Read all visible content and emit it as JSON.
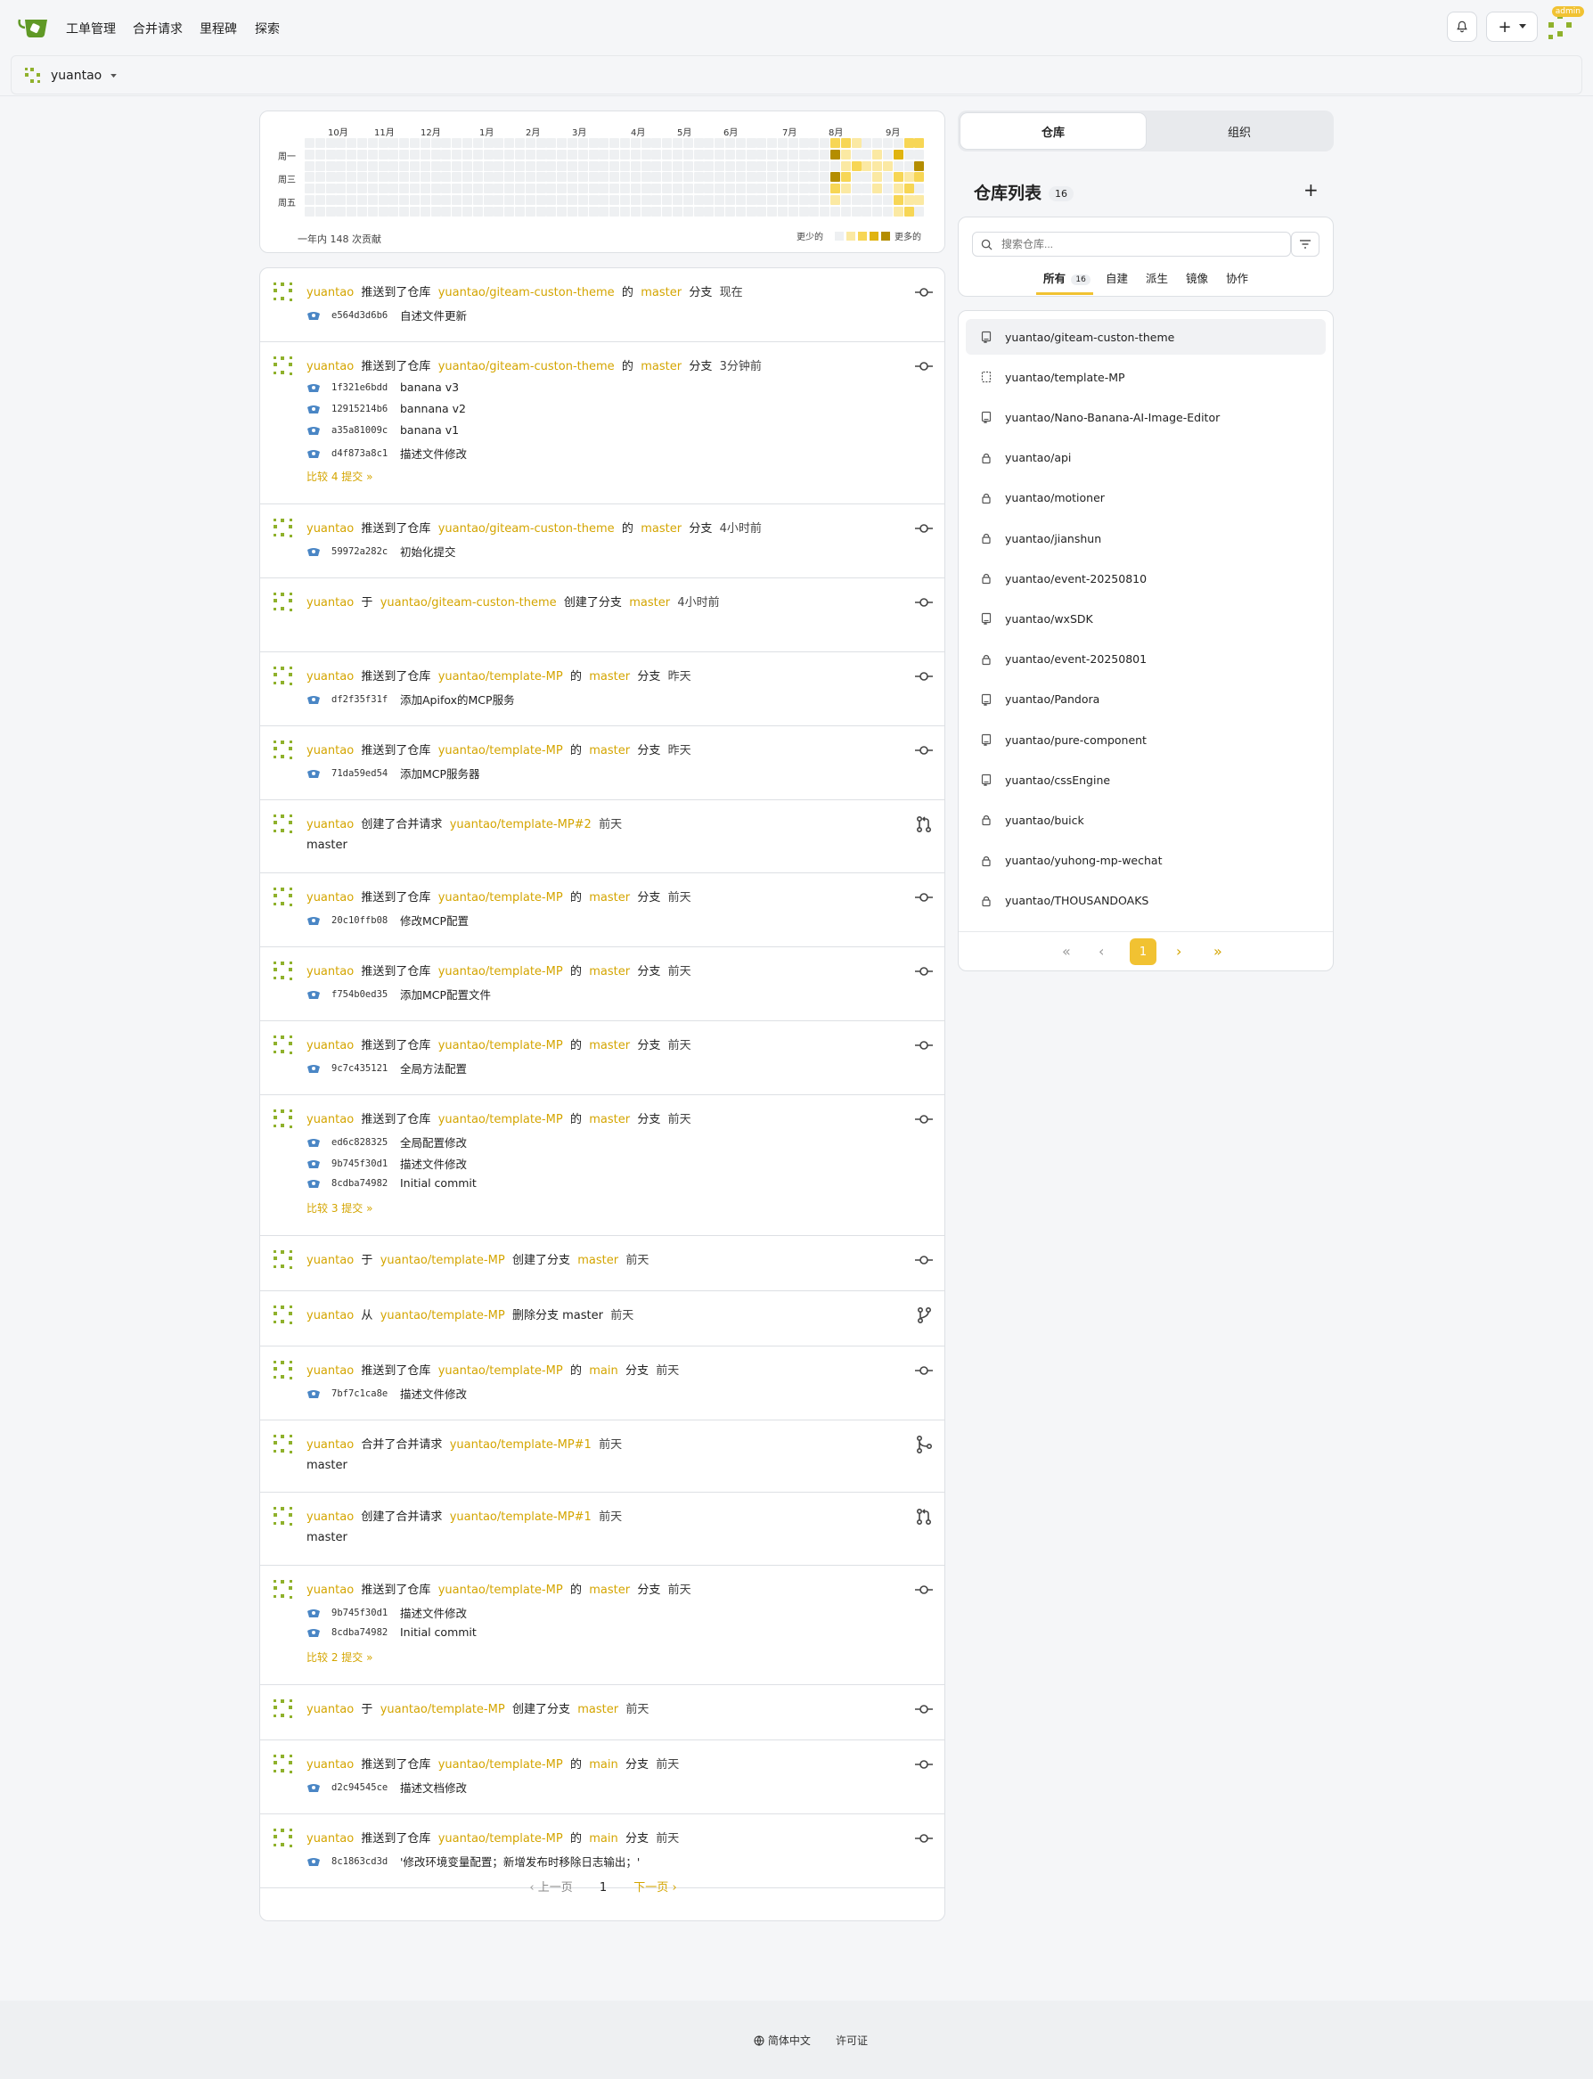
{
  "nav": {
    "items": [
      "工单管理",
      "合并请求",
      "里程碑",
      "探索"
    ],
    "admin_badge": "admin"
  },
  "context": {
    "user": "yuantao"
  },
  "heatmap": {
    "months": [
      "10月",
      "11月",
      "12月",
      "1月",
      "2月",
      "3月",
      "4月",
      "5月",
      "6月",
      "7月",
      "8月",
      "9月"
    ],
    "weekdays": [
      "周一",
      "周三",
      "周五"
    ],
    "summary": "一年内 148 次贡献",
    "less": "更少的",
    "more": "更多的",
    "colors": [
      "#eef0f2",
      "#fbe9a3",
      "#f7d655",
      "#e0b411",
      "#b48d00"
    ]
  },
  "feed": {
    "items": [
      {
        "user": "yuantao",
        "action": "推送到了仓库",
        "repo": "yuantao/giteam-custon-theme",
        "of": "的",
        "branch": "master",
        "suffix": "分支",
        "time": "现在",
        "icon": "commit-icon",
        "commits": [
          {
            "sha": "e564d3d6b6",
            "msg": "自述文件更新"
          }
        ]
      },
      {
        "user": "yuantao",
        "action": "推送到了仓库",
        "repo": "yuantao/giteam-custon-theme",
        "of": "的",
        "branch": "master",
        "suffix": "分支",
        "time": "3分钟前",
        "icon": "commit-icon",
        "commits": [
          {
            "sha": "1f321e6bdd",
            "msg": "banana v3"
          },
          {
            "sha": "12915214b6",
            "msg": "bannana v2"
          },
          {
            "sha": "a35a81009c",
            "msg": "banana v1"
          },
          {
            "sha": "d4f873a8c1",
            "msg": "描述文件修改"
          }
        ],
        "compare": "比较 4 提交 »"
      },
      {
        "user": "yuantao",
        "action": "推送到了仓库",
        "repo": "yuantao/giteam-custon-theme",
        "of": "的",
        "branch": "master",
        "suffix": "分支",
        "time": "4小时前",
        "icon": "commit-icon",
        "commits": [
          {
            "sha": "59972a282c",
            "msg": "初始化提交"
          }
        ]
      },
      {
        "user": "yuantao",
        "action": "于",
        "repo": "yuantao/giteam-custon-theme",
        "of": "创建了分支",
        "branch": "master",
        "suffix": "",
        "time": "4小时前",
        "icon": "commit-icon",
        "commits": []
      },
      {
        "user": "yuantao",
        "action": "推送到了仓库",
        "repo": "yuantao/template-MP",
        "of": "的",
        "branch": "master",
        "suffix": "分支",
        "time": "昨天",
        "icon": "commit-icon",
        "commits": [
          {
            "sha": "df2f35f31f",
            "msg": "添加Apifox的MCP服务"
          }
        ]
      },
      {
        "user": "yuantao",
        "action": "推送到了仓库",
        "repo": "yuantao/template-MP",
        "of": "的",
        "branch": "master",
        "suffix": "分支",
        "time": "昨天",
        "icon": "commit-icon",
        "commits": [
          {
            "sha": "71da59ed54",
            "msg": "添加MCP服务器"
          }
        ]
      },
      {
        "user": "yuantao",
        "action": "创建了合并请求",
        "repo": "yuantao/template-MP#2",
        "of": "",
        "branch": "",
        "suffix": "",
        "time": "前天",
        "icon": "pull-request-icon",
        "commits": [],
        "sub": "master"
      },
      {
        "user": "yuantao",
        "action": "推送到了仓库",
        "repo": "yuantao/template-MP",
        "of": "的",
        "branch": "master",
        "suffix": "分支",
        "time": "前天",
        "icon": "commit-icon",
        "commits": [
          {
            "sha": "20c10ffb08",
            "msg": "修改MCP配置"
          }
        ]
      },
      {
        "user": "yuantao",
        "action": "推送到了仓库",
        "repo": "yuantao/template-MP",
        "of": "的",
        "branch": "master",
        "suffix": "分支",
        "time": "前天",
        "icon": "commit-icon",
        "commits": [
          {
            "sha": "f754b0ed35",
            "msg": "添加MCP配置文件"
          }
        ]
      },
      {
        "user": "yuantao",
        "action": "推送到了仓库",
        "repo": "yuantao/template-MP",
        "of": "的",
        "branch": "master",
        "suffix": "分支",
        "time": "前天",
        "icon": "commit-icon",
        "commits": [
          {
            "sha": "9c7c435121",
            "msg": "全局方法配置"
          }
        ]
      },
      {
        "user": "yuantao",
        "action": "推送到了仓库",
        "repo": "yuantao/template-MP",
        "of": "的",
        "branch": "master",
        "suffix": "分支",
        "time": "前天",
        "icon": "commit-icon",
        "commits": [
          {
            "sha": "ed6c828325",
            "msg": "全局配置修改"
          },
          {
            "sha": "9b745f30d1",
            "msg": "描述文件修改"
          },
          {
            "sha": "8cdba74982",
            "msg": "Initial commit"
          }
        ],
        "compare": "比较 3 提交 »"
      },
      {
        "user": "yuantao",
        "action": "于",
        "repo": "yuantao/template-MP",
        "of": "创建了分支",
        "branch": "master",
        "suffix": "",
        "time": "前天",
        "icon": "commit-icon",
        "commits": []
      },
      {
        "user": "yuantao",
        "action": "从",
        "repo": "yuantao/template-MP",
        "of": "删除分支 master",
        "branch": "",
        "suffix": "",
        "time": "前天",
        "icon": "branch-icon",
        "commits": []
      },
      {
        "user": "yuantao",
        "action": "推送到了仓库",
        "repo": "yuantao/template-MP",
        "of": "的",
        "branch": "main",
        "suffix": "分支",
        "time": "前天",
        "icon": "commit-icon",
        "commits": [
          {
            "sha": "7bf7c1ca8e",
            "msg": "描述文件修改"
          }
        ]
      },
      {
        "user": "yuantao",
        "action": "合并了合并请求",
        "repo": "yuantao/template-MP#1",
        "of": "",
        "branch": "",
        "suffix": "",
        "time": "前天",
        "icon": "merge-icon",
        "commits": [],
        "sub": "master"
      },
      {
        "user": "yuantao",
        "action": "创建了合并请求",
        "repo": "yuantao/template-MP#1",
        "of": "",
        "branch": "",
        "suffix": "",
        "time": "前天",
        "icon": "pull-request-icon",
        "commits": [],
        "sub": "master"
      },
      {
        "user": "yuantao",
        "action": "推送到了仓库",
        "repo": "yuantao/template-MP",
        "of": "的",
        "branch": "master",
        "suffix": "分支",
        "time": "前天",
        "icon": "commit-icon",
        "commits": [
          {
            "sha": "9b745f30d1",
            "msg": "描述文件修改"
          },
          {
            "sha": "8cdba74982",
            "msg": "Initial commit"
          }
        ],
        "compare": "比较 2 提交 »"
      },
      {
        "user": "yuantao",
        "action": "于",
        "repo": "yuantao/template-MP",
        "of": "创建了分支",
        "branch": "master",
        "suffix": "",
        "time": "前天",
        "icon": "commit-icon",
        "commits": []
      },
      {
        "user": "yuantao",
        "action": "推送到了仓库",
        "repo": "yuantao/template-MP",
        "of": "的",
        "branch": "main",
        "suffix": "分支",
        "time": "前天",
        "icon": "commit-icon",
        "commits": [
          {
            "sha": "d2c94545ce",
            "msg": "描述文档修改"
          }
        ]
      },
      {
        "user": "yuantao",
        "action": "推送到了仓库",
        "repo": "yuantao/template-MP",
        "of": "的",
        "branch": "main",
        "suffix": "分支",
        "time": "前天",
        "icon": "commit-icon",
        "commits": [
          {
            "sha": "8c1863cd3d",
            "msg": "'修改环境变量配置；新增发布时移除日志输出；'"
          }
        ]
      }
    ],
    "pager": {
      "prev": "上一页",
      "page": "1",
      "next": "下一页"
    }
  },
  "sidebar": {
    "tabs": {
      "repos": "仓库",
      "orgs": "组织"
    },
    "title": "仓库列表",
    "count": "16",
    "add": "+",
    "search_placeholder": "搜索仓库...",
    "filters": [
      {
        "label": "所有",
        "count": "16"
      },
      {
        "label": "自建"
      },
      {
        "label": "派生"
      },
      {
        "label": "镜像"
      },
      {
        "label": "协作"
      }
    ],
    "repos": [
      {
        "name": "yuantao/giteam-custon-theme",
        "icon": "repo-icon"
      },
      {
        "name": "yuantao/template-MP",
        "icon": "template-repo-icon"
      },
      {
        "name": "yuantao/Nano-Banana-AI-Image-Editor",
        "icon": "repo-icon"
      },
      {
        "name": "yuantao/api",
        "icon": "lock-icon"
      },
      {
        "name": "yuantao/motioner",
        "icon": "lock-icon"
      },
      {
        "name": "yuantao/jianshun",
        "icon": "lock-icon"
      },
      {
        "name": "yuantao/event-20250810",
        "icon": "lock-icon"
      },
      {
        "name": "yuantao/wxSDK",
        "icon": "repo-icon"
      },
      {
        "name": "yuantao/event-20250801",
        "icon": "lock-icon"
      },
      {
        "name": "yuantao/Pandora",
        "icon": "repo-icon"
      },
      {
        "name": "yuantao/pure-component",
        "icon": "repo-icon"
      },
      {
        "name": "yuantao/cssEngine",
        "icon": "repo-icon"
      },
      {
        "name": "yuantao/buick",
        "icon": "lock-icon"
      },
      {
        "name": "yuantao/yuhong-mp-wechat",
        "icon": "lock-icon"
      },
      {
        "name": "yuantao/THOUSANDOAKS",
        "icon": "lock-icon"
      }
    ],
    "pager": {
      "first": "«",
      "prev": "‹",
      "current": "1",
      "next": "›",
      "last": "»"
    }
  },
  "footer": {
    "language": "简体中文",
    "license": "许可证"
  }
}
